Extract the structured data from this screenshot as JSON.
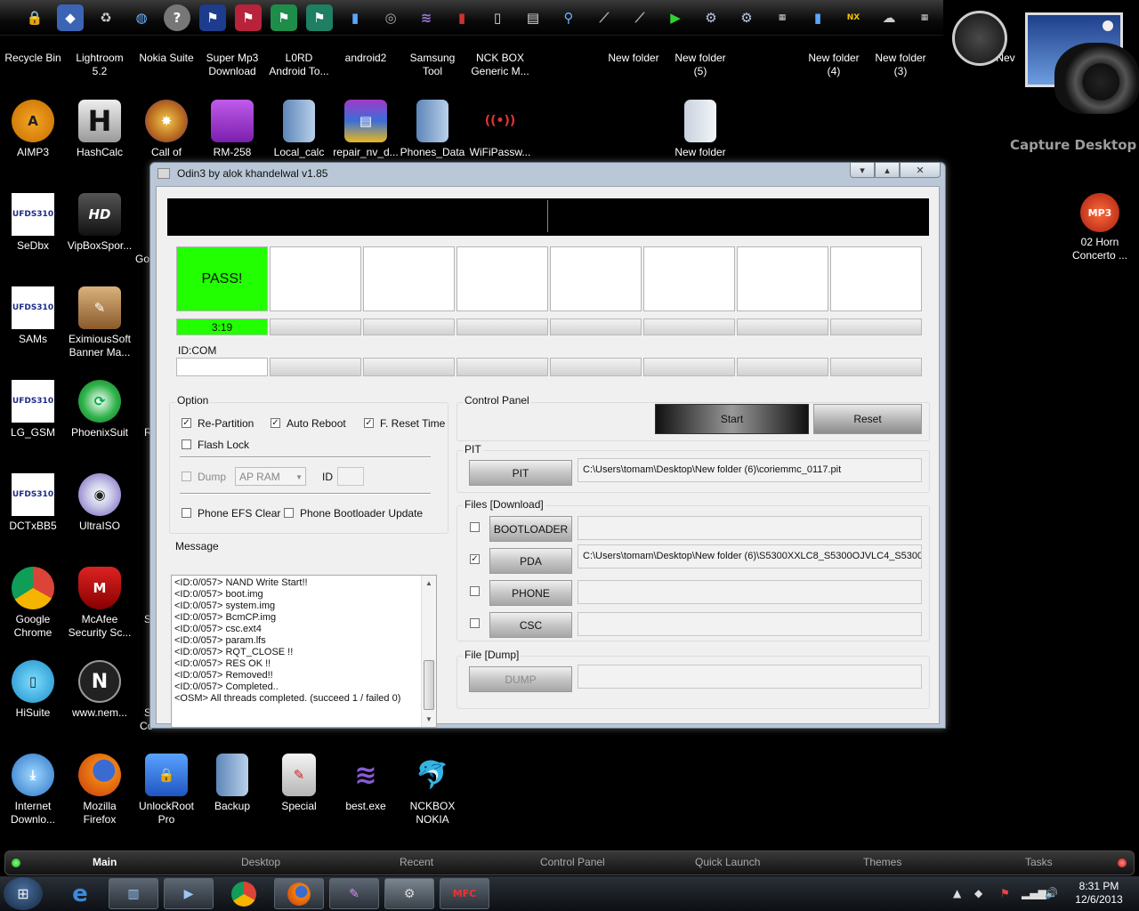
{
  "top_launcher": {
    "icons": [
      "lock-icon",
      "shield-icon",
      "recycle-icon",
      "globe-icon",
      "help-icon",
      "flag-icon",
      "flag-icon",
      "flag-icon",
      "flag-icon",
      "phone-icon",
      "disc-icon",
      "stack-icon",
      "phone-icon",
      "phone-icon",
      "film-icon",
      "wrench-icon",
      "tool-icon",
      "tool-icon",
      "play-icon",
      "gear-icon",
      "gear-icon",
      "meter-icon",
      "phone-icon",
      "nexus-icon",
      "weather-icon",
      "meter-icon"
    ]
  },
  "desktop": {
    "top_row": [
      {
        "label": "Recycle Bin",
        "icon": "recycle-bin-icon"
      },
      {
        "label": "Lightroom\n5.2",
        "icon": "lightroom-icon"
      },
      {
        "label": "Nokia Suite",
        "icon": "nokia-suite-icon"
      },
      {
        "label": "Super Mp3\nDownload",
        "icon": "mp3-download-icon"
      },
      {
        "label": "L0RD\nAndroid To...",
        "icon": "android-tool-icon"
      },
      {
        "label": "android2",
        "icon": "android-icon"
      },
      {
        "label": "Samsung\nTool",
        "icon": "samsung-tool-icon"
      },
      {
        "label": "NCK BOX\nGeneric M...",
        "icon": "nck-box-icon"
      },
      {
        "label": "New folder",
        "icon": "folder-icon"
      },
      {
        "label": "New folder\n(5)",
        "icon": "folder-icon"
      },
      {
        "label": "New folder\n(4)",
        "icon": "folder-icon"
      },
      {
        "label": "New folder\n(3)",
        "icon": "folder-icon"
      },
      {
        "label": "Nev",
        "icon": "folder-icon"
      }
    ],
    "row2": [
      {
        "label": "AIMP3",
        "glyph": "A"
      },
      {
        "label": "HashCalc",
        "glyph": "H"
      },
      {
        "label": "Call of",
        "glyph": "✸"
      },
      {
        "label": "RM-258",
        "glyph": ""
      },
      {
        "label": "Local_calc",
        "glyph": ""
      },
      {
        "label": "repair_nv_d...",
        "glyph": "▤"
      },
      {
        "label": "Phones_Data",
        "glyph": ""
      },
      {
        "label": "WiFiPassw...",
        "glyph": "((•))"
      },
      {
        "label": "New folder",
        "glyph": ""
      }
    ],
    "left_col": [
      {
        "label": "SeDbx",
        "glyph": "UFDS310"
      },
      {
        "label": "SAMs",
        "glyph": "UFDS310"
      },
      {
        "label": "LG_GSM",
        "glyph": "UFDS310"
      },
      {
        "label": "DCTxBB5",
        "glyph": "UFDS310"
      },
      {
        "label": "Google\nChrome",
        "glyph": ""
      },
      {
        "label": "HiSuite",
        "glyph": "▯"
      }
    ],
    "second_col": [
      {
        "label": "VipBoxSpor...",
        "glyph": "HD"
      },
      {
        "label": "EximiousSoft\nBanner Ma...",
        "glyph": "✎"
      },
      {
        "label": "PhoenixSuit",
        "glyph": "⟳"
      },
      {
        "label": "UltraISO",
        "glyph": "◉"
      },
      {
        "label": "McAfee\nSecurity Sc...",
        "glyph": "M"
      },
      {
        "label": "www.nem...",
        "glyph": "N"
      }
    ],
    "partial_col": [
      "Go",
      "",
      "R",
      "",
      "S",
      "S",
      "Co"
    ],
    "bottom_row": [
      {
        "label": "Internet\nDownlo...",
        "glyph": "⤓"
      },
      {
        "label": "Mozilla\nFirefox",
        "glyph": ""
      },
      {
        "label": "UnlockRoot\nPro",
        "glyph": "🔒"
      },
      {
        "label": "Backup",
        "glyph": ""
      },
      {
        "label": "Special",
        "glyph": "✎"
      },
      {
        "label": "best.exe",
        "glyph": "≋"
      },
      {
        "label": "NCKBOX\nNOKIA",
        "glyph": "🐬"
      }
    ],
    "right_col": [
      {
        "label": "02 Horn\nConcerto ...",
        "glyph": "MP3"
      }
    ],
    "widget_label": "Capture Desktop"
  },
  "odin": {
    "title": "Odin3 by alok khandelwal v1.85",
    "slots": [
      "PASS!",
      "",
      "",
      "",
      "",
      "",
      "",
      ""
    ],
    "progress": [
      "3:19",
      "",
      "",
      "",
      "",
      "",
      "",
      ""
    ],
    "id_com_label": "ID:COM",
    "option": {
      "header": "Option",
      "re_partition": {
        "label": "Re-Partition",
        "checked": true
      },
      "auto_reboot": {
        "label": "Auto Reboot",
        "checked": true
      },
      "f_reset_time": {
        "label": "F. Reset Time",
        "checked": true
      },
      "flash_lock": {
        "label": "Flash Lock",
        "checked": false
      },
      "dump": {
        "label": "Dump",
        "checked": false,
        "disabled": true
      },
      "dump_select": "AP RAM",
      "id_label": "ID",
      "phone_efs_clear": {
        "label": "Phone EFS Clear",
        "checked": false
      },
      "phone_bootloader_update": {
        "label": "Phone Bootloader Update",
        "checked": false
      }
    },
    "message": {
      "header": "Message",
      "lines": [
        "<ID:0/057> NAND Write Start!!",
        "<ID:0/057> boot.img",
        "<ID:0/057> system.img",
        "<ID:0/057> BcmCP.img",
        "<ID:0/057> csc.ext4",
        "<ID:0/057> param.lfs",
        "<ID:0/057> RQT_CLOSE !!",
        "<ID:0/057> RES OK !!",
        "<ID:0/057> Removed!!",
        "<ID:0/057> Completed..",
        "<OSM> All threads completed. (succeed 1 / failed 0)"
      ]
    },
    "control_panel": {
      "header": "Control Panel",
      "start": "Start",
      "reset": "Reset"
    },
    "pit": {
      "header": "PIT",
      "button": "PIT",
      "path": "C:\\Users\\tomam\\Desktop\\New folder (6)\\coriemmc_0117.pit"
    },
    "files": {
      "header": "Files [Download]",
      "rows": [
        {
          "label": "BOOTLOADER",
          "checked": false,
          "path": ""
        },
        {
          "label": "PDA",
          "checked": true,
          "path": "C:\\Users\\tomam\\Desktop\\New folder (6)\\S5300XXLC8_S5300OJVLC4_S5300XX"
        },
        {
          "label": "PHONE",
          "checked": false,
          "path": ""
        },
        {
          "label": "CSC",
          "checked": false,
          "path": ""
        }
      ]
    },
    "dump_section": {
      "header": "File [Dump]",
      "button": "DUMP",
      "path": ""
    }
  },
  "tabbar": {
    "tabs": [
      {
        "label": "Main",
        "active": true
      },
      {
        "label": "Desktop",
        "active": false
      },
      {
        "label": "Recent",
        "active": false
      },
      {
        "label": "Control Panel",
        "active": false
      },
      {
        "label": "Quick Launch",
        "active": false
      },
      {
        "label": "Themes",
        "active": false
      },
      {
        "label": "Tasks",
        "active": false
      }
    ]
  },
  "taskbar": {
    "time": "8:31 PM",
    "date": "12/6/2013",
    "items": [
      "ie-icon",
      "explorer-icon",
      "media-icon",
      "chrome-icon",
      "firefox-icon",
      "paint-icon",
      "odin-icon",
      "mfc-icon"
    ]
  },
  "colors": {
    "pass_green": "#22ff00",
    "desktop_bg": "#000000"
  }
}
